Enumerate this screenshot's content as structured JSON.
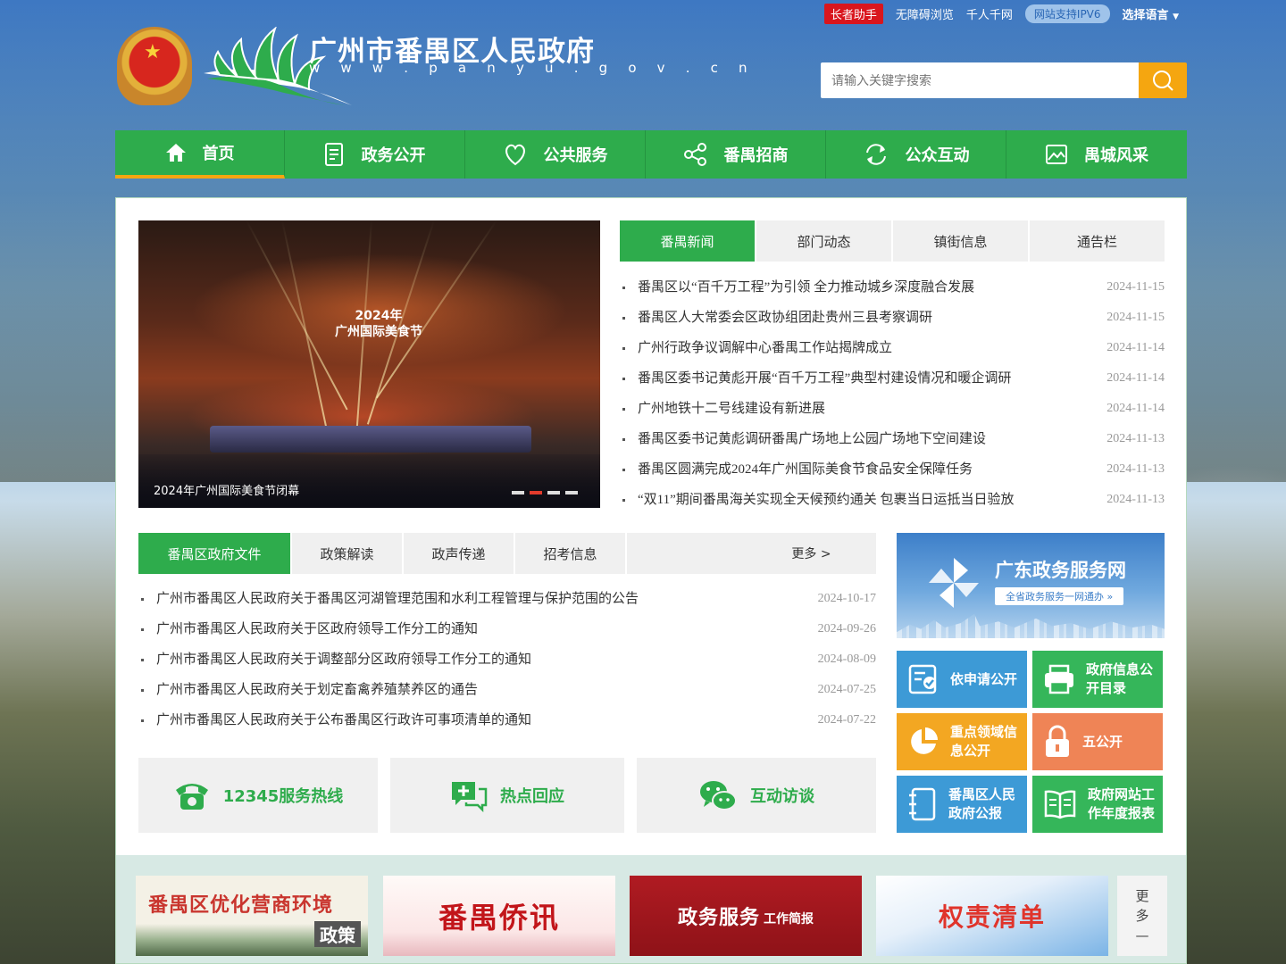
{
  "topbar": {
    "elder": "长者助手",
    "accessible": "无障碍浏览",
    "qianren": "千人千网",
    "ipv6": "网站支持IPV6",
    "lang": "选择语言"
  },
  "header": {
    "title": "广州市番禺区人民政府",
    "url": "w w w . p a n y u . g o v . c n",
    "search_placeholder": "请输入关键字搜索"
  },
  "nav": [
    {
      "label": "首页",
      "icon": "home-icon"
    },
    {
      "label": "政务公开",
      "icon": "document-icon"
    },
    {
      "label": "公共服务",
      "icon": "heart-icon"
    },
    {
      "label": "番禺招商",
      "icon": "share-icon"
    },
    {
      "label": "公众互动",
      "icon": "refresh-icon"
    },
    {
      "label": "禺城风采",
      "icon": "picture-icon"
    }
  ],
  "slide": {
    "caption": "2024年广州国际美食节闭幕",
    "overlay_line1": "2024年",
    "overlay_line2": "广州国际美食节"
  },
  "news_tabs": [
    "番禺新闻",
    "部门动态",
    "镇街信息",
    "通告栏"
  ],
  "news": [
    {
      "title": "番禺区以“百千万工程”为引领 全力推动城乡深度融合发展",
      "date": "2024-11-15"
    },
    {
      "title": "番禺区人大常委会区政协组团赴贵州三县考察调研",
      "date": "2024-11-15"
    },
    {
      "title": "广州行政争议调解中心番禺工作站揭牌成立",
      "date": "2024-11-14"
    },
    {
      "title": "番禺区委书记黄彪开展“百千万工程”典型村建设情况和暖企调研",
      "date": "2024-11-14"
    },
    {
      "title": "广州地铁十二号线建设有新进展",
      "date": "2024-11-14"
    },
    {
      "title": "番禺区委书记黄彪调研番禺广场地上公园广场地下空间建设",
      "date": "2024-11-13"
    },
    {
      "title": "番禺区圆满完成2024年广州国际美食节食品安全保障任务",
      "date": "2024-11-13"
    },
    {
      "title": "“双11”期间番禺海关实现全天候预约通关 包裹当日运抵当日验放",
      "date": "2024-11-13"
    }
  ],
  "doc_tabs": [
    "番禺区政府文件",
    "政策解读",
    "政声传递",
    "招考信息"
  ],
  "doc_more": "更多 >",
  "docs": [
    {
      "title": "广州市番禺区人民政府关于番禺区河湖管理范围和水利工程管理与保护范围的公告",
      "date": "2024-10-17"
    },
    {
      "title": "广州市番禺区人民政府关于区政府领导工作分工的通知",
      "date": "2024-09-26"
    },
    {
      "title": "广州市番禺区人民政府关于调整部分区政府领导工作分工的通知",
      "date": "2024-08-09"
    },
    {
      "title": "广州市番禺区人民政府关于划定畜禽养殖禁养区的通告",
      "date": "2024-07-25"
    },
    {
      "title": "广州市番禺区人民政府关于公布番禺区行政许可事项清单的通知",
      "date": "2024-07-22"
    }
  ],
  "services": [
    {
      "label": "12345服务热线",
      "icon": "phone-icon"
    },
    {
      "label": "热点回应",
      "icon": "chat-plus-icon"
    },
    {
      "label": "互动访谈",
      "icon": "wechat-icon"
    }
  ],
  "gd_banner": {
    "title": "广东政务服务网",
    "sub": "全省政务服务一网通办 »"
  },
  "tiles": [
    {
      "label": "依申请公开",
      "color": "#3d9ad6",
      "icon": "form-check-icon"
    },
    {
      "label": "政府信息公开目录",
      "color": "#35b65a",
      "icon": "printer-icon"
    },
    {
      "label": "重点领域信息公开",
      "color": "#f3a722",
      "icon": "pie-chart-icon"
    },
    {
      "label": "五公开",
      "color": "#ef8456",
      "icon": "lock-icon"
    },
    {
      "label": "番禺区人民政府公报",
      "color": "#3d9ad6",
      "icon": "notebook-icon"
    },
    {
      "label": "政府网站工作年度报表",
      "color": "#35b65a",
      "icon": "book-open-icon"
    }
  ],
  "banners": [
    {
      "main": "番禺区优化营商环境",
      "tag": "政策"
    },
    {
      "main": "番禺侨讯"
    },
    {
      "main": "政务服务",
      "small": "工作简报"
    },
    {
      "main": "权责清单"
    }
  ],
  "bottom_more": [
    "更",
    "多",
    "—"
  ]
}
